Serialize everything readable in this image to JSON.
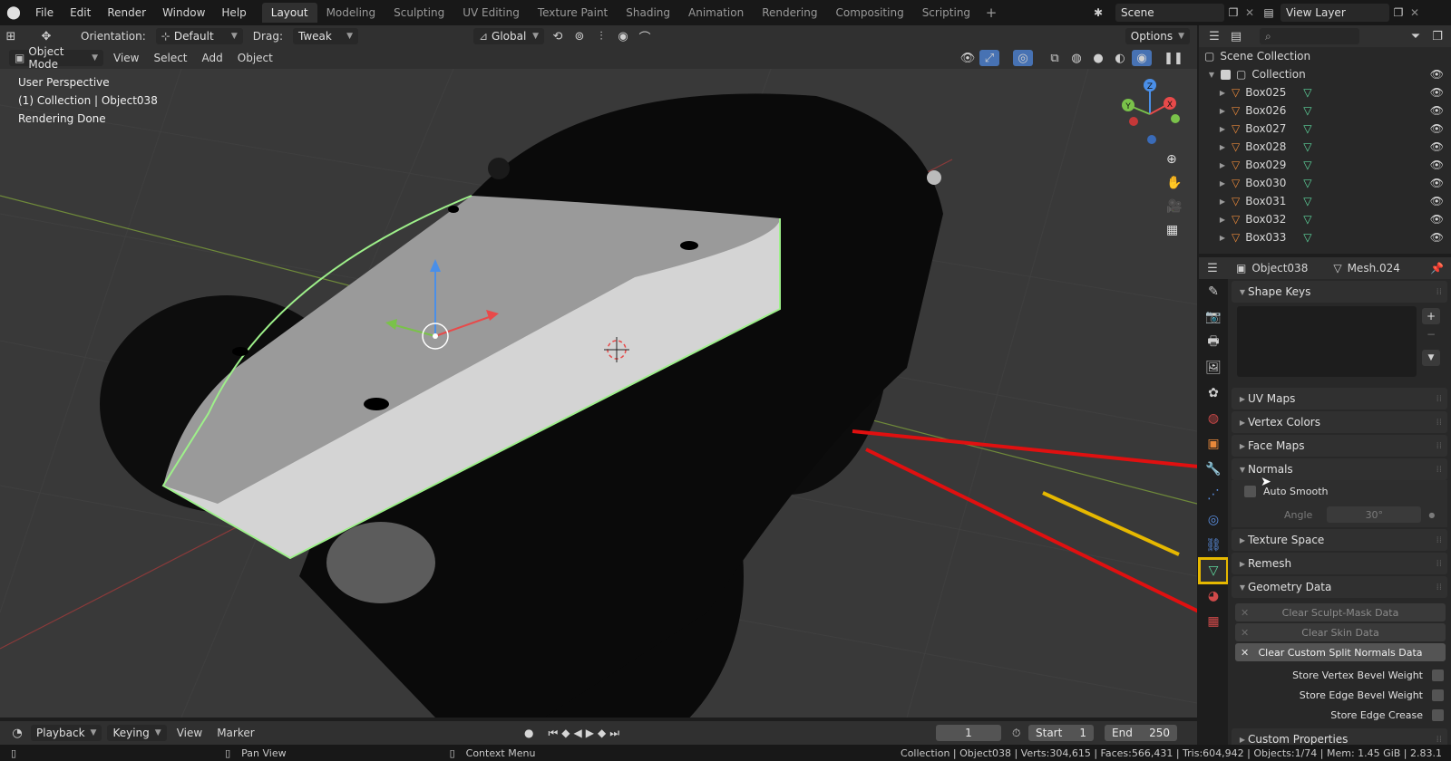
{
  "topbar": {
    "menus": [
      "File",
      "Edit",
      "Render",
      "Window",
      "Help"
    ],
    "workspaces": [
      "Layout",
      "Modeling",
      "Sculpting",
      "UV Editing",
      "Texture Paint",
      "Shading",
      "Animation",
      "Rendering",
      "Compositing",
      "Scripting"
    ],
    "active_workspace": "Layout",
    "add_tab": "+",
    "scene": "Scene",
    "view_layer": "View Layer"
  },
  "viewport_header": {
    "orientation_label": "Orientation:",
    "orientation_value": "Default",
    "drag_label": "Drag:",
    "drag_value": "Tweak",
    "transform_space": "Global",
    "options": "Options",
    "mode": "Object Mode",
    "menus": [
      "View",
      "Select",
      "Add",
      "Object"
    ]
  },
  "viewport": {
    "info_lines": [
      "User Perspective",
      "(1) Collection | Object038",
      "Rendering Done"
    ],
    "gizmo_axes": {
      "x": "X",
      "y": "Y",
      "z": "Z"
    }
  },
  "outliner": {
    "root": "Scene Collection",
    "collection": "Collection",
    "items": [
      "Box025",
      "Box026",
      "Box027",
      "Box028",
      "Box029",
      "Box030",
      "Box031",
      "Box032",
      "Box033"
    ]
  },
  "properties": {
    "object_name": "Object038",
    "mesh_name": "Mesh.024",
    "panels": {
      "shape_keys": "Shape Keys",
      "uv_maps": "UV Maps",
      "vertex_colors": "Vertex Colors",
      "face_maps": "Face Maps",
      "normals": "Normals",
      "auto_smooth": "Auto Smooth",
      "angle_label": "Angle",
      "angle_value": "30°",
      "texture_space": "Texture Space",
      "remesh": "Remesh",
      "geometry_data": "Geometry Data",
      "custom_properties": "Custom Properties"
    },
    "geometry_buttons": [
      "Clear Sculpt-Mask Data",
      "Clear Skin Data",
      "Clear Custom Split Normals Data"
    ],
    "geometry_checks": [
      "Store Vertex Bevel Weight",
      "Store Edge Bevel Weight",
      "Store Edge Crease"
    ]
  },
  "timeline": {
    "menus": [
      "Playback",
      "Keying",
      "View",
      "Marker"
    ],
    "current_frame": "1",
    "start_label": "Start",
    "start_value": "1",
    "end_label": "End",
    "end_value": "250"
  },
  "statusbar": {
    "pan": "Pan View",
    "context": "Context Menu",
    "stats": "Collection | Object038 | Verts:304,615 | Faces:566,431 | Tris:604,942 | Objects:1/74 | Mem: 1.45 GiB | 2.83.1"
  },
  "colors": {
    "accent": "#4772b3",
    "selection_outline": "#9ef08a",
    "annotation_red": "#e01010",
    "annotation_yellow": "#e6b800",
    "mesh_icon": "#5fd99f",
    "object_icon": "#e8883a"
  }
}
